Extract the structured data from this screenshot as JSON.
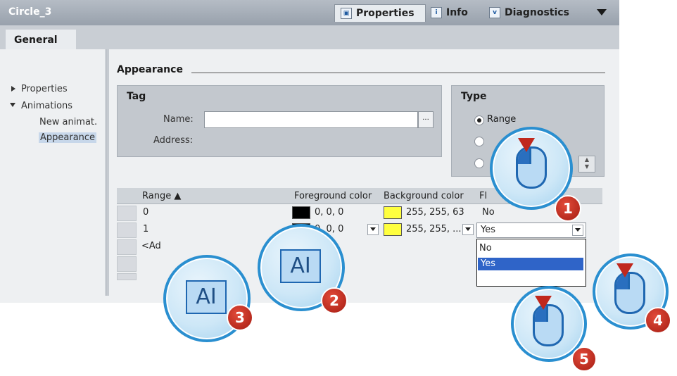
{
  "title": "Circle_3",
  "tabs": [
    "Properties",
    "Info",
    "Diagnostics"
  ],
  "tab_icons": [
    "properties-icon",
    "info-icon",
    "diagnostics-icon"
  ],
  "general_tab": "General",
  "nav": {
    "properties": "Properties",
    "animations": "Animations",
    "new_animation": "New animat.",
    "appearance": "Appearance"
  },
  "section_title": "Appearance",
  "tag": {
    "title": "Tag",
    "name_label": "Name:",
    "name_value": "",
    "browse": "...",
    "address_label": "Address:"
  },
  "type": {
    "title": "Type",
    "options": [
      "Range"
    ],
    "selected": "Range"
  },
  "table": {
    "headers": [
      "Range ▲",
      "Foreground color",
      "Background color",
      "Fl"
    ],
    "rows": [
      {
        "range": "0",
        "fg": "0, 0, 0",
        "bg": "255, 255, 63",
        "flashing": "No"
      },
      {
        "range": "1",
        "fg": "0, 0, 0",
        "bg": "255, 255, ...",
        "flashing": "Yes"
      }
    ],
    "add_row": "<Ad"
  },
  "dropdown_options": [
    "No",
    "Yes"
  ],
  "callouts": [
    "1",
    "2",
    "3",
    "4",
    "5"
  ],
  "colors": {
    "accent": "#2a8fd0",
    "badge": "#b6241a",
    "selection": "#2f64c8",
    "bg_swatch": "#ffff3f",
    "fg_swatch": "#000000"
  }
}
